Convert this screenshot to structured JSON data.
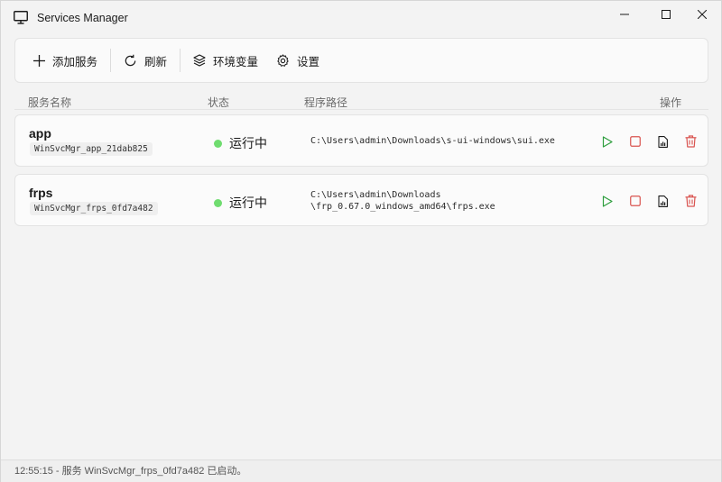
{
  "window": {
    "title": "Services Manager"
  },
  "toolbar": {
    "add_label": "添加服务",
    "refresh_label": "刷新",
    "env_label": "环境变量",
    "settings_label": "设置"
  },
  "columns": {
    "name": "服务名称",
    "status": "状态",
    "path": "程序路径",
    "ops": "操作"
  },
  "services": [
    {
      "name": "app",
      "id": "WinSvcMgr_app_21dab825",
      "status": "运行中",
      "path_line1": "C:\\Users\\admin\\Downloads\\s-ui-windows\\sui.exe",
      "path_line2": ""
    },
    {
      "name": "frps",
      "id": "WinSvcMgr_frps_0fd7a482",
      "status": "运行中",
      "path_line1": "C:\\Users\\admin\\Downloads",
      "path_line2": "\\frp_0.67.0_windows_amd64\\frps.exe"
    }
  ],
  "statusbar": {
    "message": "12:55:15 - 服务 WinSvcMgr_frps_0fd7a482 已启动。"
  },
  "colors": {
    "running": "#6fdc6f",
    "start": "#2e9e3e",
    "stop": "#d9534f",
    "delete": "#d9534f"
  }
}
